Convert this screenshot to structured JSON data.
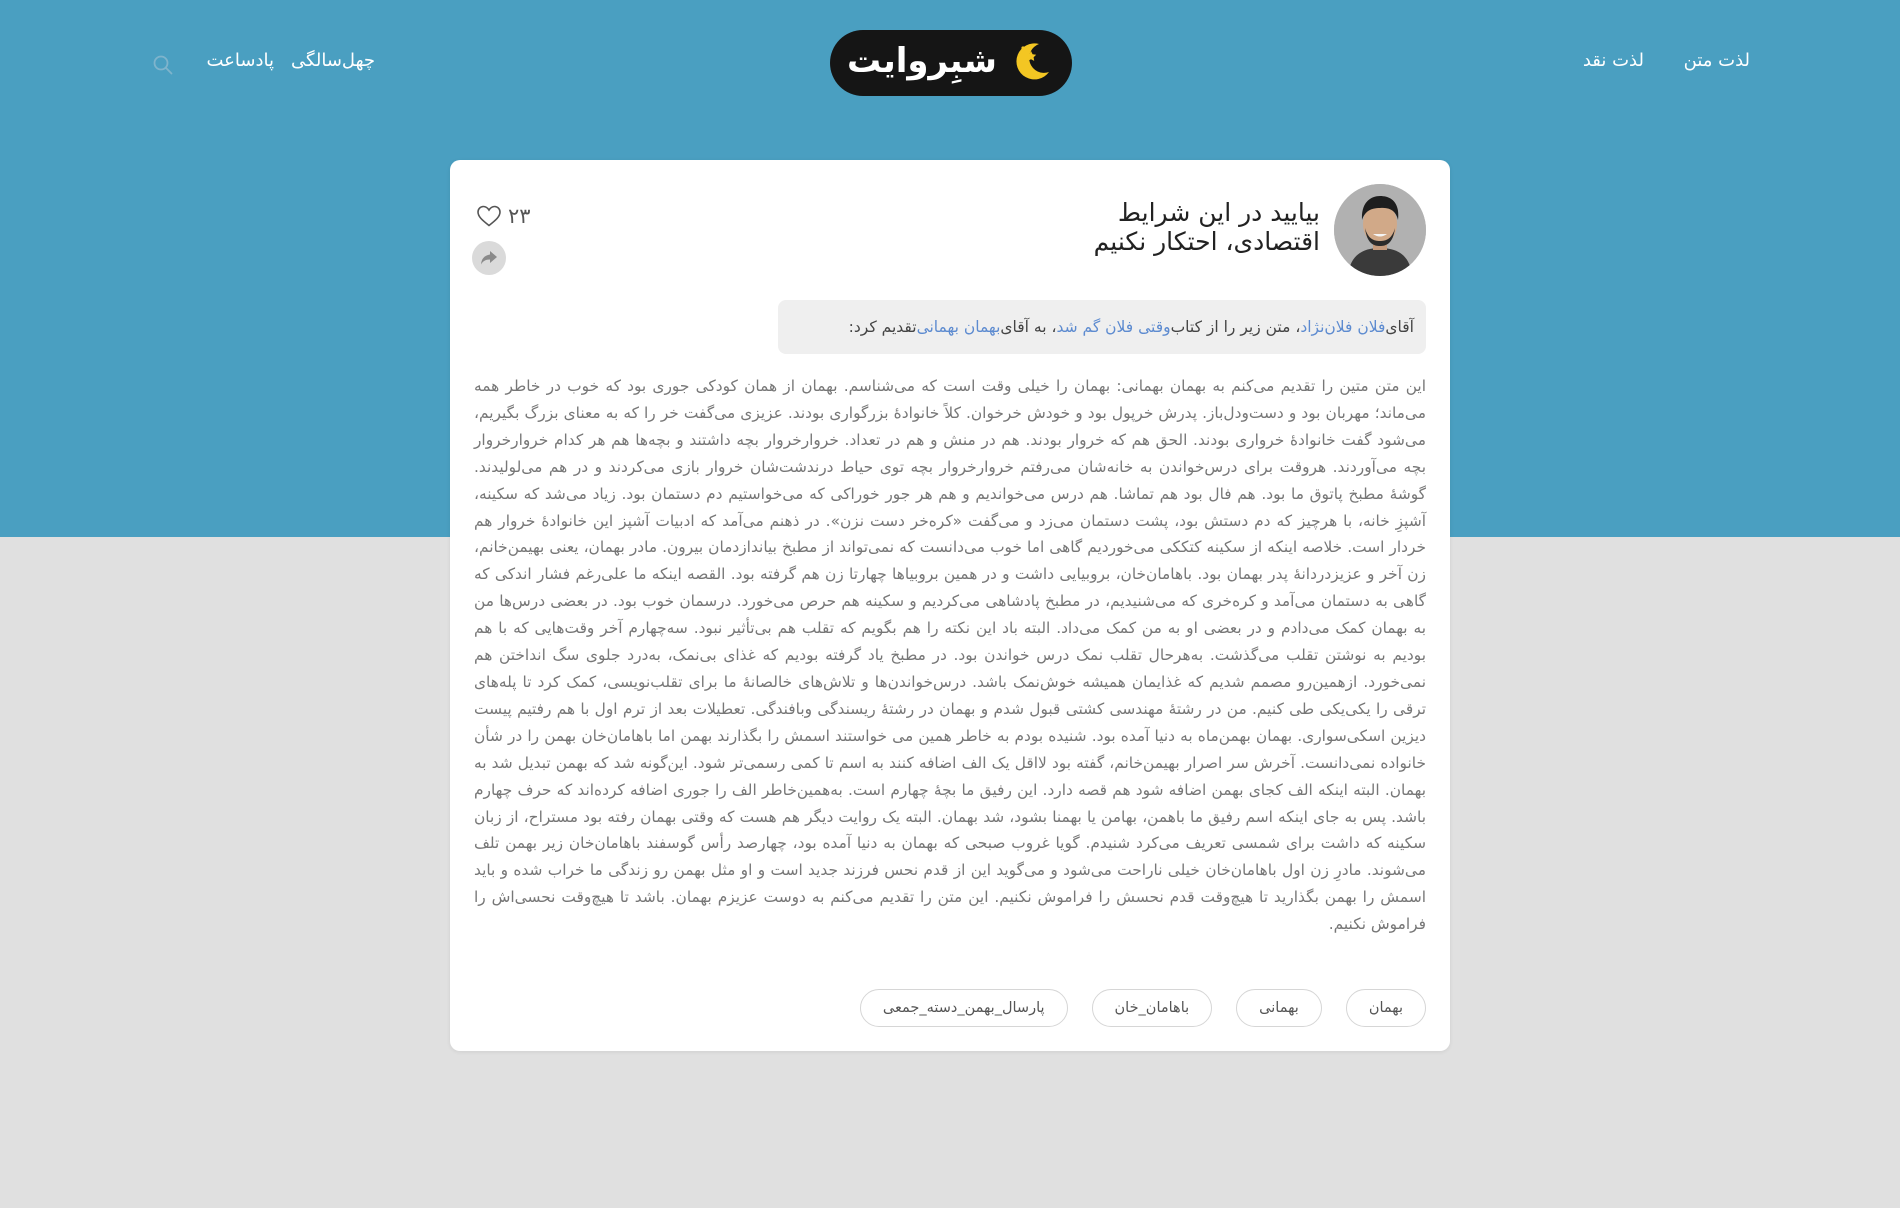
{
  "header": {
    "nav_right": [
      "لذت متن",
      "لذت نقد"
    ],
    "nav_left": [
      "چهل‌سالگی",
      "پادساعت"
    ],
    "logo_text": "شبِروایت"
  },
  "colors": {
    "header_blue": "#4a9fc1",
    "page_gray": "#e0e0e0",
    "link_blue": "#5d8bd0",
    "logo_black": "#151515",
    "moon_yellow": "#f3c623"
  },
  "icons": {
    "search": "search-icon",
    "like": "heart-icon",
    "share": "share-arrow-icon",
    "logo": "moon-stars-icon"
  },
  "post": {
    "title_line1": "بیایید در این شرایط",
    "title_line2": "اقتصادی، احتکار نکنیم",
    "likes": "۲۳",
    "intro": {
      "p1": "آقای ",
      "author": "فلان فلان‌نژاد",
      "p2": "، متن زیر را از کتاب ",
      "book": "وقتی فلان گم شد",
      "p3": "، به آقای ",
      "recipient": "بهمان بهمانی",
      "p4": " تقدیم کرد:"
    },
    "body": "این متن متین را تقدیم می‌کنم به بهمان بهمانی: بهمان را خیلی وقت است که می‌شناسم. بهمان از همان کودکی جوری بود که خوب در خاطر همه می‌ماند؛ مهربان بود و دست‌ودل‌باز. پدرش خرپول بود و خودش خرخوان. کلاً خانوادهٔ بزرگواری بودند. عزیزی می‌گفت خر را که به معنای بزرگ بگیریم، می‌شود گفت خانوادهٔ خرواری بودند. الحق هم که خروار بودند. هم در منش و هم در تعداد. خروارخروار بچه داشتند و بچه‌ها هم هر کدام خروارخروار بچه می‌آوردند. هروقت برای درس‌خواندن به خانه‌شان می‌رفتم خروارخروار بچه توی حیاط درندشت‌شان خروار بازی می‌کردند و در هم می‌لولیدند. گوشهٔ مطبخ پاتوق ما بود. هم فال بود هم تماشا. هم درس می‌خواندیم و هم هر جور خوراکی که می‌خواستیم دم دستمان بود. زیاد می‌شد که سکینه، آشپزِ خانه، با هرچیز که دم دستش بود، پشت دستمان می‌زد و می‌گفت «کره‌خر دست نزن». در ذهنم می‌آمد که ادبیات آشپز این خانوادهٔ خروار هم خردار است. خلاصه اینکه از سکینه کتککی می‌خوردیم گاهی اما خوب می‌دانست که نمی‌تواند از مطبخ بیاندازدمان بیرون. مادر بهمان، یعنی بهیمن‌خانم، زن آخر و عزیزدردانهٔ پدر بهمان بود. باهامان‌خان، بروبیایی داشت و در همین بروبیاها چهارتا زن هم گرفته بود. القصه اینکه ما علی‌رغم فشار اندکی که گاهی به دستمان می‌آمد و کره‌خری که می‌شنیدیم، در مطبخ پادشاهی می‌کردیم و سکینه هم حرص می‌خورد. درسمان خوب بود. در بعضی درس‌ها من به بهمان کمک می‌دادم و در بعضی او به من کمک می‌داد. البته باد این نکته را هم بگویم که تقلب هم بی‌تأثیر نبود. سه‌چهارم آخر وقت‌هایی که با هم بودیم به نوشتن تقلب می‌گذشت. به‌هرحال تقلب نمک درس خواندن بود. در مطبخ یاد گرفته بودیم که غذای بی‌نمک، به‌درد جلوی سگ انداختن هم نمی‌خورد. ازهمین‌رو مصمم شدیم که غذایمان همیشه خوش‌نمک باشد. درس‌خواندن‌ها و تلاش‌های خالصانهٔ ما برای تقلب‌نویسی، کمک کرد تا پله‌های ترقی را یکی‌یکی طی کنیم. من در رشتهٔ مهندسی کشتی قبول شدم و بهمان در رشتهٔ ریسندگی وبافندگی. تعطیلات بعد از ترم اول با هم رفتیم پیست دیزین اسکی‌سواری. بهمان بهمن‌ماه به دنیا آمده بود. شنیده بودم به خاطر همین می خواستند اسمش را بگذارند بهمن اما باهامان‌خان بهمن را در شأن خانواده نمی‌دانست. آخرش سر اصرار بهیمن‌خانم، گفته بود لااقل یک الف اضافه کنند به اسم تا کمی رسمی‌تر شود. این‌گونه شد که بهمن تبدیل شد به بهمان. البته اینکه الف کجای بهمن اضافه شود هم قصه دارد. این رفیق ما بچهٔ چهارم است. به‌همین‌خاطر الف را جوری اضافه کرده‌اند که حرف چهارم باشد. پس به جای اینکه اسم رفیق ما باهمن، بهامن یا بهمنا بشود، شد بهمان. البته یک روایت دیگر هم هست که وقتی بهمان رفته بود مستراح، از زبان سکینه که داشت برای شمسی تعریف می‌کرد شنیدم. گویا غروب صبحی که بهمان به دنیا آمده بود، چهارصد رأس گوسفند باهامان‌خان زیر بهمن تلف می‌شوند. مادرِ زن اول باهامان‌خان خیلی ناراحت می‌شود و می‌گوید این از قدم نحس فرزند جدید است و او مثل بهمن رو زندگی ما خراب شده و باید اسمش را بهمن بگذارید تا هیچ‌وقت قدم نحسش را فراموش نکنیم. این متن را تقدیم می‌کنم به دوست عزیزم بهمان. باشد تا هیچ‌وقت نحسی‌اش را فراموش نکنیم.",
    "tags": [
      "بهمان",
      "بهمانی",
      "باهامان_خان",
      "پارسال_بهمن_دسته_جمعی"
    ]
  }
}
